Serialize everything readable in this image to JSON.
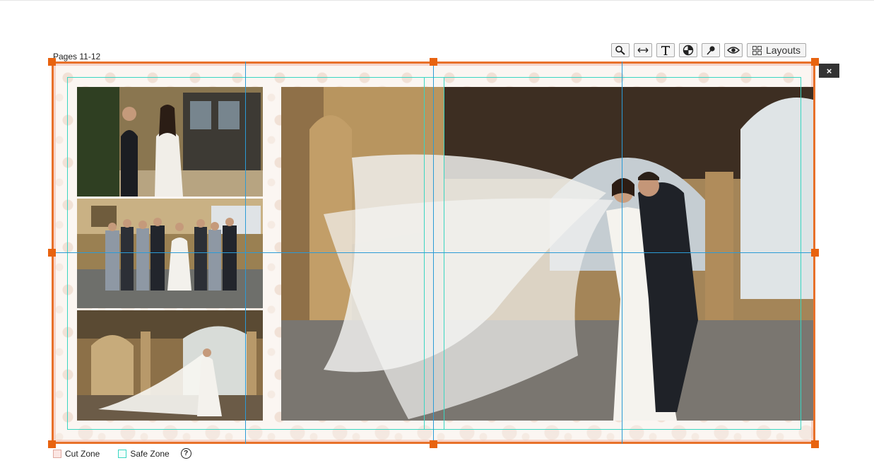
{
  "header": {
    "page_label": "Pages 11-12"
  },
  "toolbar": {
    "buttons": [
      {
        "name": "zoom-button",
        "icon": "magnifier-icon"
      },
      {
        "name": "fit-width-button",
        "icon": "horizontal-arrows-icon"
      },
      {
        "name": "text-button",
        "icon": "text-t-icon"
      },
      {
        "name": "color-button",
        "icon": "color-wheel-icon"
      },
      {
        "name": "eyedropper-button",
        "icon": "pin-icon"
      },
      {
        "name": "preview-button",
        "icon": "eye-icon"
      }
    ],
    "layouts_label": "Layouts",
    "close_glyph": "×"
  },
  "legend": {
    "cut_label": "Cut Zone",
    "safe_label": "Safe Zone",
    "help_glyph": "?"
  },
  "colors": {
    "frame": "#e8712a",
    "handle": "#e8630f",
    "guide": "#2b9bd6",
    "safe_zone": "#3ad6c2"
  }
}
